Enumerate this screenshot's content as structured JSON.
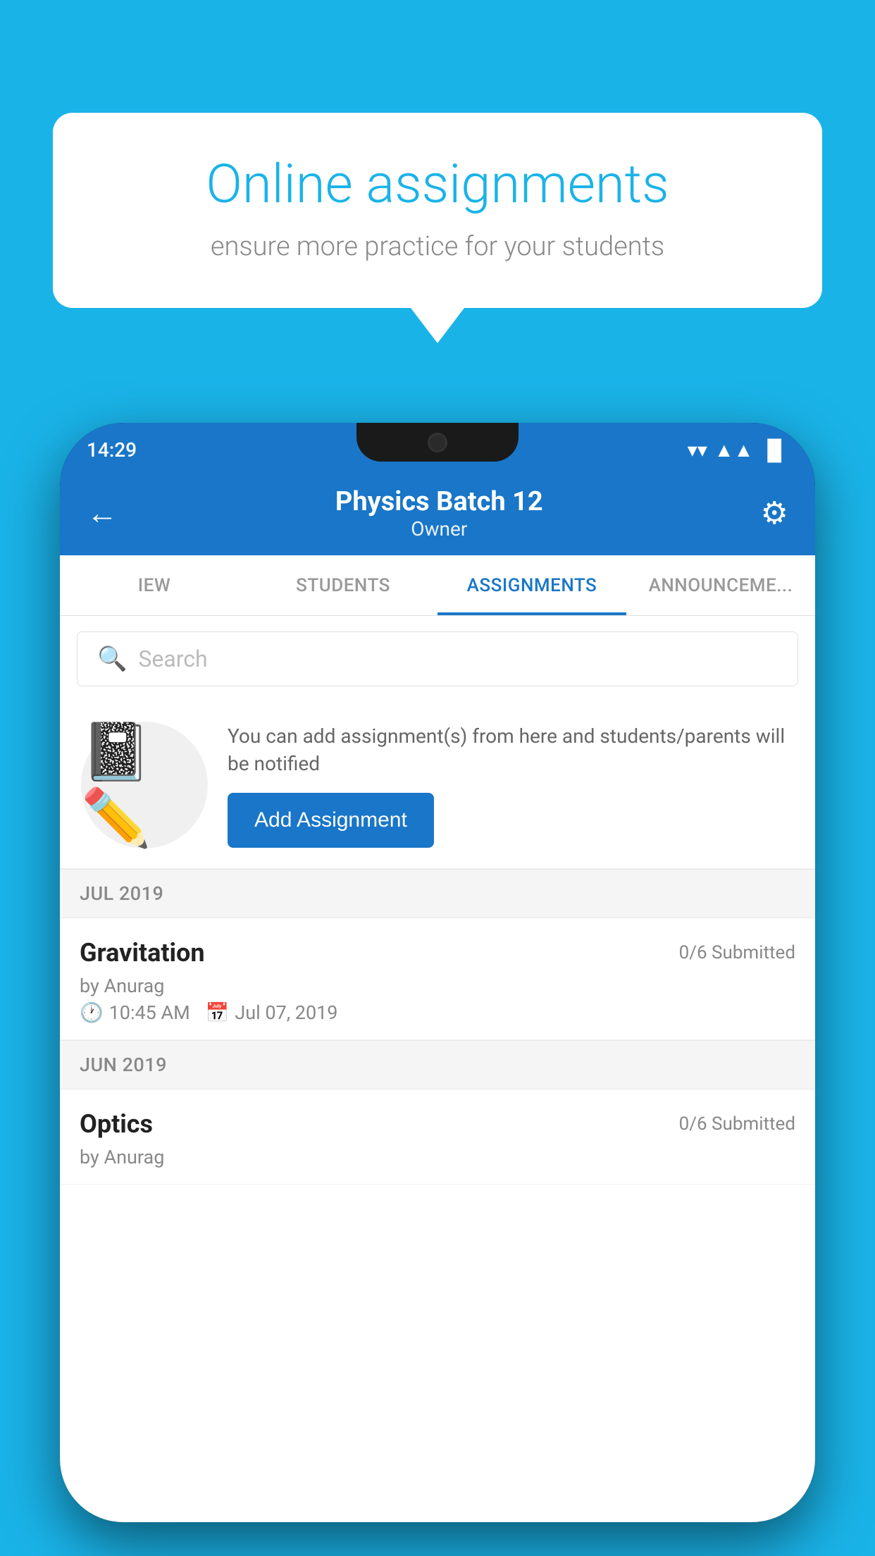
{
  "background_color": "#1ab3e8",
  "speech_bubble": {
    "title": "Online assignments",
    "subtitle": "ensure more practice for your students"
  },
  "phone": {
    "status_bar": {
      "time": "14:29",
      "wifi_icon": "▼",
      "signal_icon": "▲",
      "battery_icon": "▐"
    },
    "header": {
      "back_label": "←",
      "title": "Physics Batch 12",
      "subtitle": "Owner",
      "settings_icon": "⚙"
    },
    "tabs": [
      {
        "id": "iew",
        "label": "IEW",
        "active": false
      },
      {
        "id": "students",
        "label": "STUDENTS",
        "active": false
      },
      {
        "id": "assignments",
        "label": "ASSIGNMENTS",
        "active": true
      },
      {
        "id": "announcements",
        "label": "ANNOUNCEMENTS",
        "active": false
      }
    ],
    "search": {
      "placeholder": "Search"
    },
    "promo": {
      "description": "You can add assignment(s) from here and students/parents will be notified",
      "button_label": "Add Assignment"
    },
    "sections": [
      {
        "label": "JUL 2019",
        "assignments": [
          {
            "name": "Gravitation",
            "submitted": "0/6 Submitted",
            "by": "by Anurag",
            "time": "10:45 AM",
            "date": "Jul 07, 2019"
          }
        ]
      },
      {
        "label": "JUN 2019",
        "assignments": [
          {
            "name": "Optics",
            "submitted": "0/6 Submitted",
            "by": "by Anurag",
            "time": "",
            "date": ""
          }
        ]
      }
    ]
  }
}
